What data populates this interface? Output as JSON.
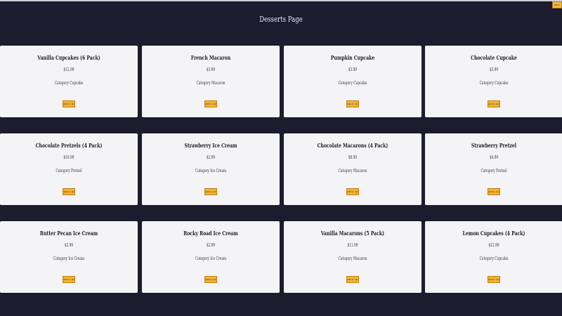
{
  "page": {
    "title": "Desserts Page",
    "corner_button_label": "Back"
  },
  "labels": {
    "category": "Category",
    "add_to_cart": "Add to cart"
  },
  "products": [
    {
      "name": "Vanilla Cupcakes (6 Pack)",
      "price": "$12.99",
      "category": "Cupcake"
    },
    {
      "name": "French Macaron",
      "price": "$3.99",
      "category": "Macaron"
    },
    {
      "name": "Pumpkin Cupcake",
      "price": "$3.99",
      "category": "Cupcake"
    },
    {
      "name": "Chocolate Cupcake",
      "price": "$3.99",
      "category": "Cupcake"
    },
    {
      "name": "Chocolate Pretzels (4 Pack)",
      "price": "$10.99",
      "category": "Pretzel"
    },
    {
      "name": "Strawberry Ice Cream",
      "price": "$2.99",
      "category": "Ice Cream"
    },
    {
      "name": "Chocolate Macarons (4 Pack)",
      "price": "$9.99",
      "category": "Macaron"
    },
    {
      "name": "Strawberry Pretzel",
      "price": "$4.99",
      "category": "Pretzel"
    },
    {
      "name": "Butter Pecan Ice Cream",
      "price": "$2.99",
      "category": "Ice Cream"
    },
    {
      "name": "Rocky Road Ice Cream",
      "price": "$2.99",
      "category": "Ice Cream"
    },
    {
      "name": "Vanilla Macarons (5 Pack)",
      "price": "$11.99",
      "category": "Macaron"
    },
    {
      "name": "Lemon Cupcakes (4 Pack)",
      "price": "$12.99",
      "category": "Cupcake"
    }
  ]
}
